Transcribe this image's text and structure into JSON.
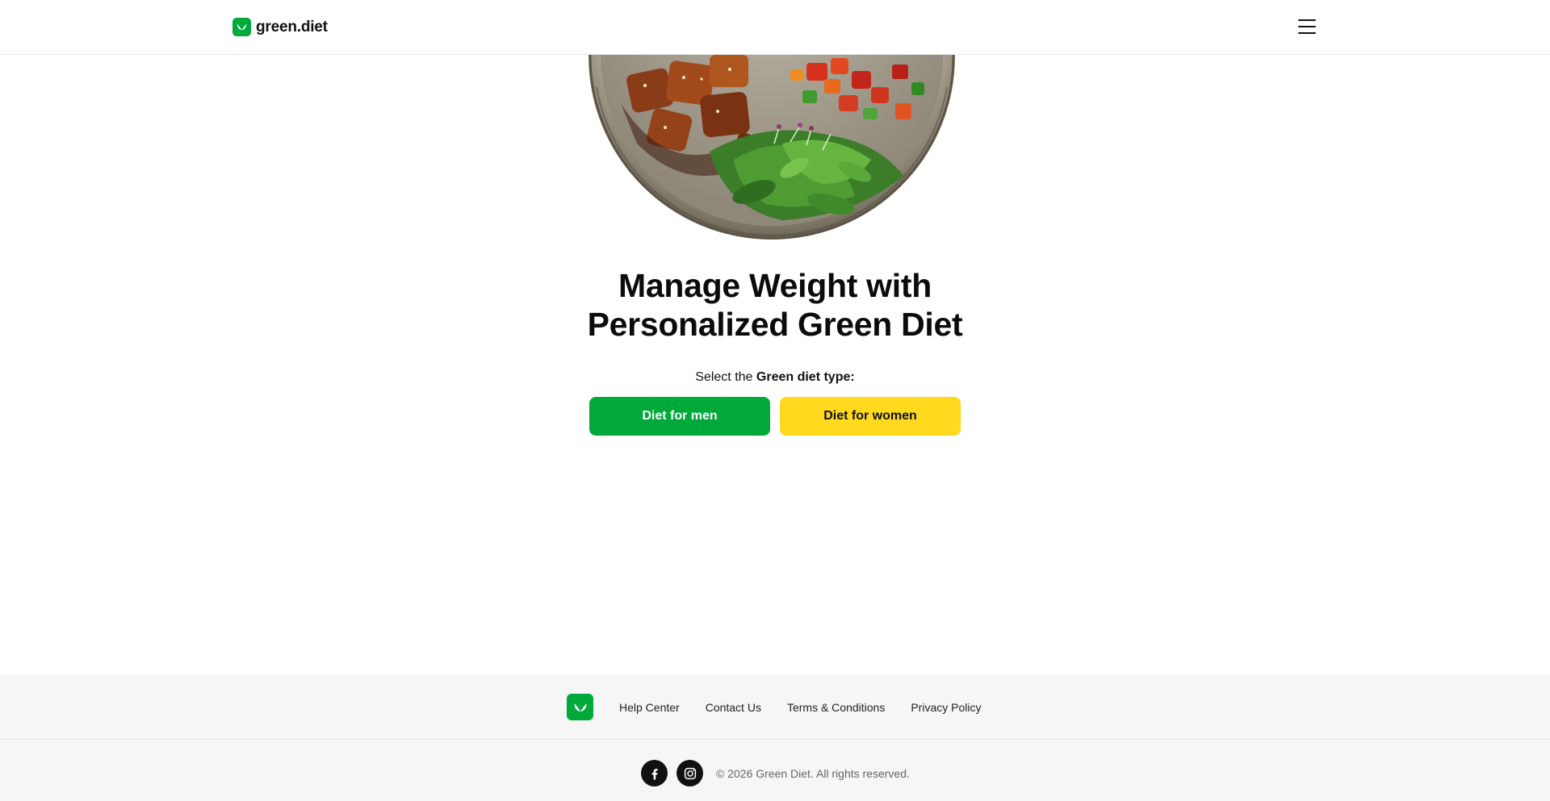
{
  "header": {
    "brand": "green.diet",
    "menu_icon": "hamburger-menu-icon"
  },
  "hero": {
    "image": "food-bowl-image",
    "title_line1": "Manage Weight with",
    "title_line2": "Personalized Green Diet",
    "select_prefix": "Select the ",
    "select_bold": "Green diet type:"
  },
  "buttons": {
    "men": "Diet for men",
    "women": "Diet for women"
  },
  "colors": {
    "brand_green": "#00a93a",
    "accent_yellow": "#ffd91e",
    "footer_bg": "#f6f6f6"
  },
  "footer": {
    "logo_icon": "leaf-logo-icon",
    "links": [
      "Help Center",
      "Contact Us",
      "Terms & Conditions",
      "Privacy Policy"
    ],
    "social": [
      "facebook-icon",
      "instagram-icon"
    ],
    "copyright": "© 2026 Green Diet. All rights reserved."
  }
}
